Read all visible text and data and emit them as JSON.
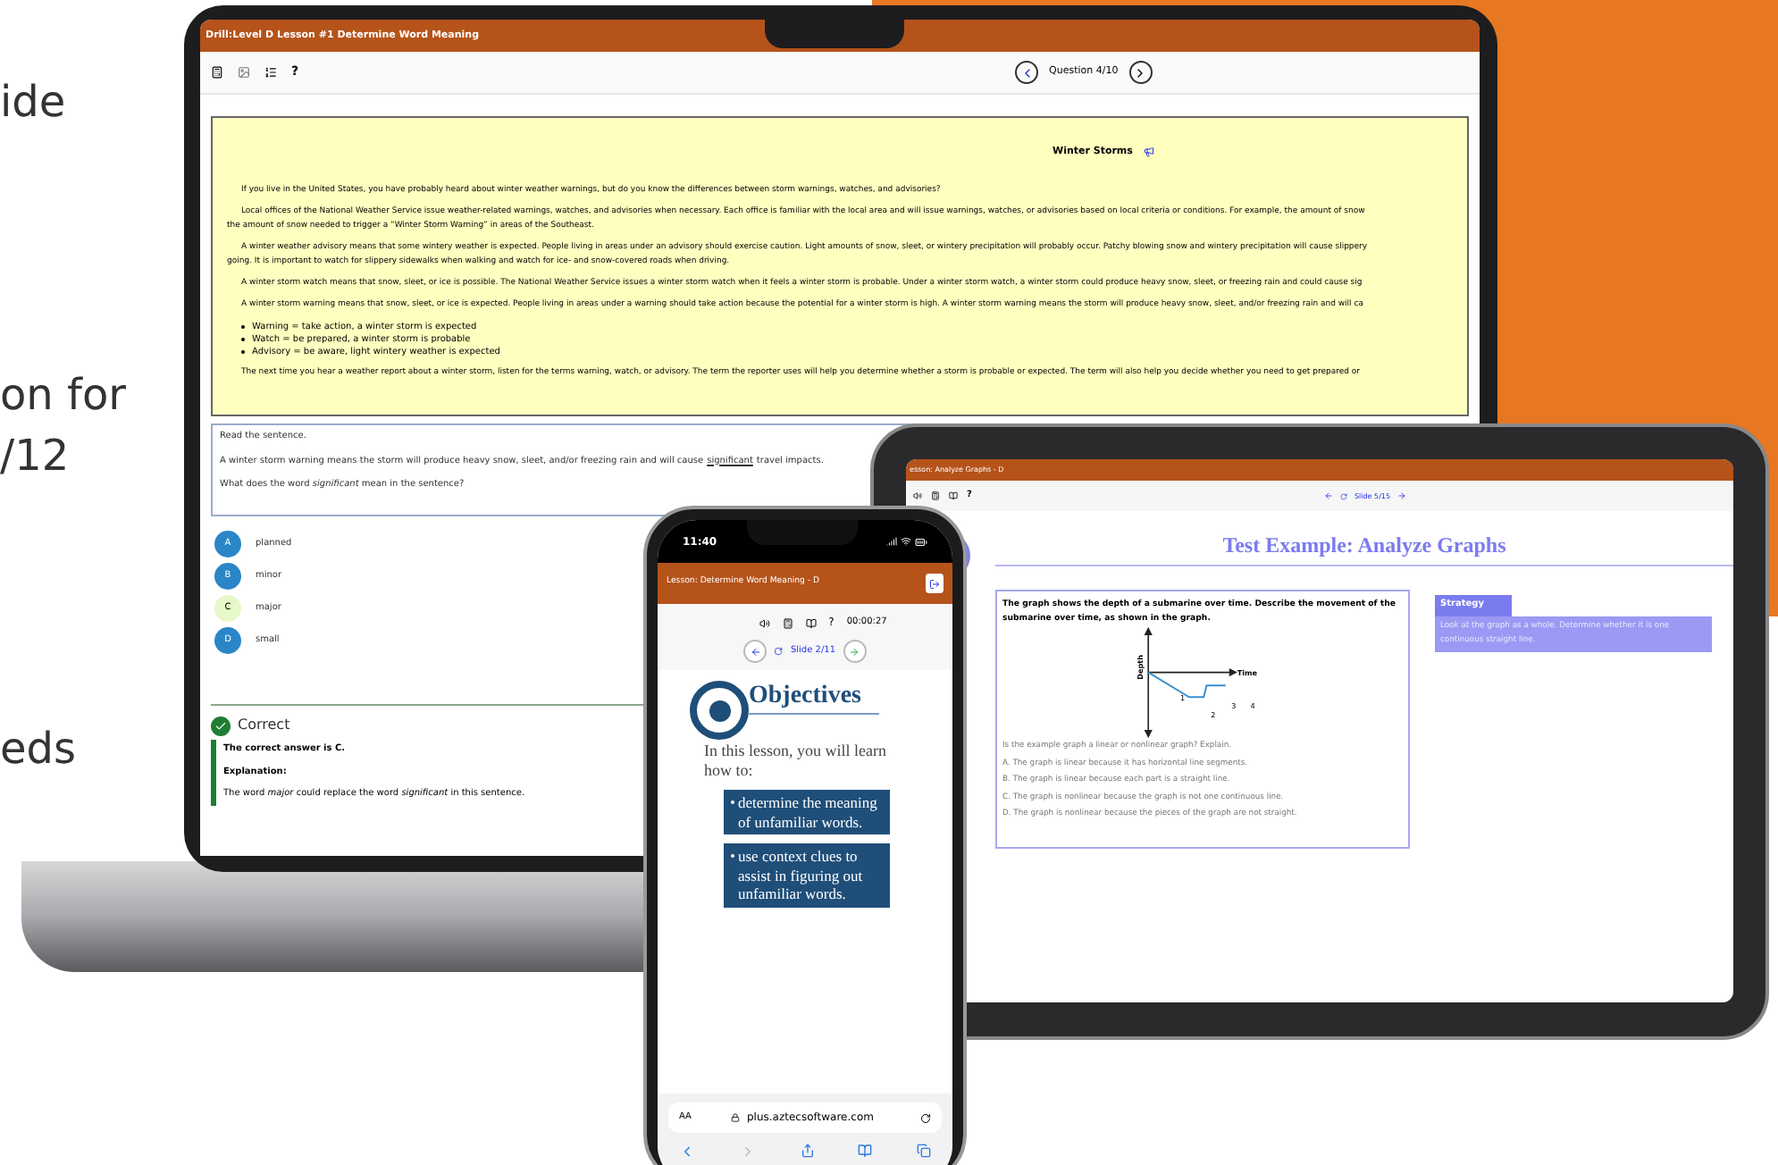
{
  "side_text": [
    "ide",
    "on for",
    "/12",
    "eds"
  ],
  "laptop": {
    "header_title": "Drill:Level D Lesson #1 Determine Word Meaning",
    "help": "?",
    "question_counter": "Question 4/10",
    "passage": {
      "title": "Winter Storms",
      "lines": [
        {
          "kind": "indent",
          "text": "If you live in the United States, you have probably heard about winter weather warnings, but do you know the differences between storm warnings, watches, and advisories?"
        },
        {
          "kind": "indent",
          "text": "Local offices of the National Weather Service issue weather-related warnings, watches, and advisories when necessary. Each office is familiar with the local area and will issue warnings, watches, or advisories based on local criteria or conditions. For example, the amount of snow"
        },
        {
          "kind": "cont",
          "text": "the amount of snow needed to trigger a “Winter Storm Warning” in areas of the Southeast."
        },
        {
          "kind": "indent",
          "text": "A winter weather advisory means that some wintery weather is expected. People living in areas under an advisory should exercise caution. Light amounts of snow, sleet, or wintery precipitation will probably occur. Patchy blowing snow and wintery precipitation will cause slippery"
        },
        {
          "kind": "cont",
          "text": "going. It is important to watch for slippery sidewalks when walking and watch for ice- and snow-covered roads when driving."
        },
        {
          "kind": "indent",
          "text": "A winter storm watch means that snow, sleet, or ice is possible. The National Weather Service issues a winter storm watch when it feels a winter storm is probable. Under a winter storm watch, a winter storm could produce heavy snow, sleet, or freezing rain and could cause sig"
        },
        {
          "kind": "indent",
          "text": "A winter storm warning means that snow, sleet, or ice is expected. People living in areas under a warning should take action because the potential for a winter storm is high. A winter storm warning means the storm will produce heavy snow, sleet, and/or freezing rain and will ca"
        },
        {
          "kind": "bullet",
          "text": "Warning = take action, a winter storm is expected"
        },
        {
          "kind": "bullet",
          "text": "Watch = be prepared, a winter storm is probable"
        },
        {
          "kind": "bullet",
          "text": "Advisory = be aware, light wintery weather is expected"
        },
        {
          "kind": "indent",
          "text": "The next time you hear a weather report about a winter storm, listen for the terms warning, watch, or advisory. The term the reporter uses will help you determine whether a storm is probable or expected. The term will also help you decide whether you need to get prepared or"
        }
      ]
    },
    "question": {
      "prompt": "Read the sentence.",
      "sentence_before": "A winter storm warning means the storm will produce heavy snow, sleet, and/or freezing rain and will cause",
      "sentence_word": "significant",
      "sentence_after": "travel impacts.",
      "ask": "What does the word *significant* mean in the sentence?"
    },
    "options": [
      {
        "letter": "A",
        "text": "planned",
        "selected": false
      },
      {
        "letter": "B",
        "text": "minor",
        "selected": false
      },
      {
        "letter": "C",
        "text": "major",
        "selected": true
      },
      {
        "letter": "D",
        "text": "small",
        "selected": false
      }
    ],
    "feedback": {
      "status": "Correct",
      "answer": "The correct answer is C.",
      "label": "Explanation:",
      "explanation": "The word *major* could replace the word *significant* in this sentence."
    }
  },
  "tablet": {
    "header_title": "esson: Analyze Graphs - D",
    "help": "?",
    "slide_counter": "Slide 5/15",
    "title": "Test Example: Analyze Graphs",
    "prompt": "The graph shows the depth of a submarine over time. Describe the movement of the submarine over time, as shown in the graph.",
    "graph_labels": {
      "y_axis": "Depth",
      "x_axis": "Time",
      "segments": [
        "1",
        "2",
        "3",
        "4"
      ]
    },
    "question_lines": [
      "Is the example graph a linear or nonlinear graph? Explain.",
      "A. The graph is linear because it has horizontal line segments.",
      "B. The graph is linear because each part is a straight line.",
      "C. The graph is nonlinear because the graph is not one continuous line.",
      "D. The graph is nonlinear because the pieces of the graph are not straight."
    ],
    "strategy": {
      "heading": "Strategy",
      "text": "Look at the graph as a whole. Determine whether it is one continuous straight line."
    }
  },
  "phone": {
    "time": "11:40",
    "header_title": "Lesson: Determine Word Meaning - D",
    "help": "?",
    "timer": "00:00:27",
    "slide_counter": "Slide 2/11",
    "heading": "Objectives",
    "intro": "In this lesson, you will learn how to:",
    "objectives": [
      "determine the meaning of unfamiliar words.",
      "use context clues to assist in figuring out unfamiliar words."
    ],
    "text_size": "AA",
    "url": "plus.aztecsoftware.com"
  }
}
